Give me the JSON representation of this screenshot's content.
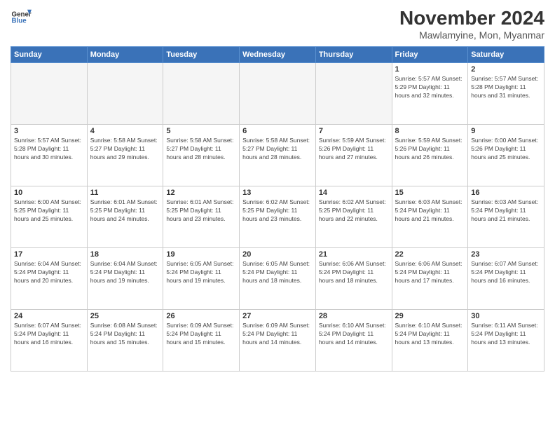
{
  "logo": {
    "line1": "General",
    "line2": "Blue"
  },
  "title": "November 2024",
  "location": "Mawlamyine, Mon, Myanmar",
  "days_of_week": [
    "Sunday",
    "Monday",
    "Tuesday",
    "Wednesday",
    "Thursday",
    "Friday",
    "Saturday"
  ],
  "weeks": [
    [
      {
        "day": "",
        "info": ""
      },
      {
        "day": "",
        "info": ""
      },
      {
        "day": "",
        "info": ""
      },
      {
        "day": "",
        "info": ""
      },
      {
        "day": "",
        "info": ""
      },
      {
        "day": "1",
        "info": "Sunrise: 5:57 AM\nSunset: 5:29 PM\nDaylight: 11 hours\nand 32 minutes."
      },
      {
        "day": "2",
        "info": "Sunrise: 5:57 AM\nSunset: 5:28 PM\nDaylight: 11 hours\nand 31 minutes."
      }
    ],
    [
      {
        "day": "3",
        "info": "Sunrise: 5:57 AM\nSunset: 5:28 PM\nDaylight: 11 hours\nand 30 minutes."
      },
      {
        "day": "4",
        "info": "Sunrise: 5:58 AM\nSunset: 5:27 PM\nDaylight: 11 hours\nand 29 minutes."
      },
      {
        "day": "5",
        "info": "Sunrise: 5:58 AM\nSunset: 5:27 PM\nDaylight: 11 hours\nand 28 minutes."
      },
      {
        "day": "6",
        "info": "Sunrise: 5:58 AM\nSunset: 5:27 PM\nDaylight: 11 hours\nand 28 minutes."
      },
      {
        "day": "7",
        "info": "Sunrise: 5:59 AM\nSunset: 5:26 PM\nDaylight: 11 hours\nand 27 minutes."
      },
      {
        "day": "8",
        "info": "Sunrise: 5:59 AM\nSunset: 5:26 PM\nDaylight: 11 hours\nand 26 minutes."
      },
      {
        "day": "9",
        "info": "Sunrise: 6:00 AM\nSunset: 5:26 PM\nDaylight: 11 hours\nand 25 minutes."
      }
    ],
    [
      {
        "day": "10",
        "info": "Sunrise: 6:00 AM\nSunset: 5:25 PM\nDaylight: 11 hours\nand 25 minutes."
      },
      {
        "day": "11",
        "info": "Sunrise: 6:01 AM\nSunset: 5:25 PM\nDaylight: 11 hours\nand 24 minutes."
      },
      {
        "day": "12",
        "info": "Sunrise: 6:01 AM\nSunset: 5:25 PM\nDaylight: 11 hours\nand 23 minutes."
      },
      {
        "day": "13",
        "info": "Sunrise: 6:02 AM\nSunset: 5:25 PM\nDaylight: 11 hours\nand 23 minutes."
      },
      {
        "day": "14",
        "info": "Sunrise: 6:02 AM\nSunset: 5:25 PM\nDaylight: 11 hours\nand 22 minutes."
      },
      {
        "day": "15",
        "info": "Sunrise: 6:03 AM\nSunset: 5:24 PM\nDaylight: 11 hours\nand 21 minutes."
      },
      {
        "day": "16",
        "info": "Sunrise: 6:03 AM\nSunset: 5:24 PM\nDaylight: 11 hours\nand 21 minutes."
      }
    ],
    [
      {
        "day": "17",
        "info": "Sunrise: 6:04 AM\nSunset: 5:24 PM\nDaylight: 11 hours\nand 20 minutes."
      },
      {
        "day": "18",
        "info": "Sunrise: 6:04 AM\nSunset: 5:24 PM\nDaylight: 11 hours\nand 19 minutes."
      },
      {
        "day": "19",
        "info": "Sunrise: 6:05 AM\nSunset: 5:24 PM\nDaylight: 11 hours\nand 19 minutes."
      },
      {
        "day": "20",
        "info": "Sunrise: 6:05 AM\nSunset: 5:24 PM\nDaylight: 11 hours\nand 18 minutes."
      },
      {
        "day": "21",
        "info": "Sunrise: 6:06 AM\nSunset: 5:24 PM\nDaylight: 11 hours\nand 18 minutes."
      },
      {
        "day": "22",
        "info": "Sunrise: 6:06 AM\nSunset: 5:24 PM\nDaylight: 11 hours\nand 17 minutes."
      },
      {
        "day": "23",
        "info": "Sunrise: 6:07 AM\nSunset: 5:24 PM\nDaylight: 11 hours\nand 16 minutes."
      }
    ],
    [
      {
        "day": "24",
        "info": "Sunrise: 6:07 AM\nSunset: 5:24 PM\nDaylight: 11 hours\nand 16 minutes."
      },
      {
        "day": "25",
        "info": "Sunrise: 6:08 AM\nSunset: 5:24 PM\nDaylight: 11 hours\nand 15 minutes."
      },
      {
        "day": "26",
        "info": "Sunrise: 6:09 AM\nSunset: 5:24 PM\nDaylight: 11 hours\nand 15 minutes."
      },
      {
        "day": "27",
        "info": "Sunrise: 6:09 AM\nSunset: 5:24 PM\nDaylight: 11 hours\nand 14 minutes."
      },
      {
        "day": "28",
        "info": "Sunrise: 6:10 AM\nSunset: 5:24 PM\nDaylight: 11 hours\nand 14 minutes."
      },
      {
        "day": "29",
        "info": "Sunrise: 6:10 AM\nSunset: 5:24 PM\nDaylight: 11 hours\nand 13 minutes."
      },
      {
        "day": "30",
        "info": "Sunrise: 6:11 AM\nSunset: 5:24 PM\nDaylight: 11 hours\nand 13 minutes."
      }
    ]
  ]
}
